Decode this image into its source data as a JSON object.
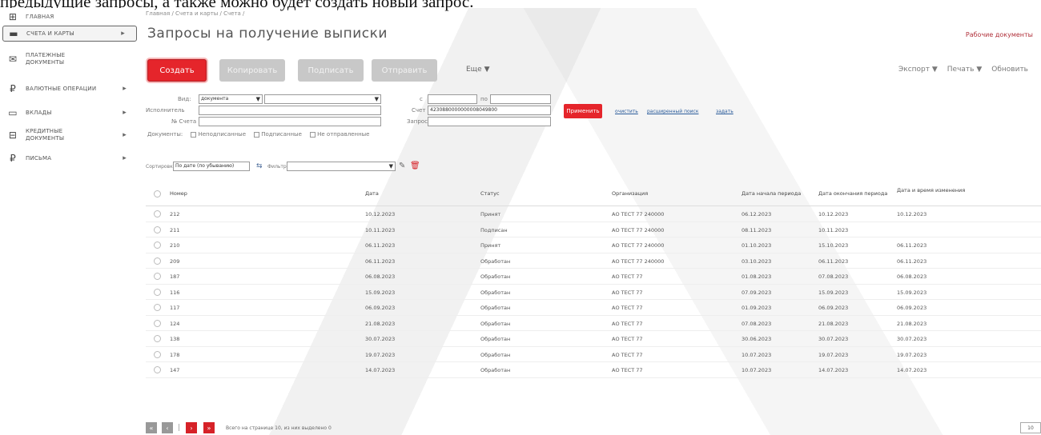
{
  "caption": "предыдущие запросы, а также можно будет создать новый запрос.",
  "sidebar": {
    "items": [
      {
        "label": "Главная",
        "icon": "home-icon",
        "glyph": "⊞",
        "arrow": ""
      },
      {
        "label": "Счета и карты",
        "icon": "card-icon",
        "glyph": "▬",
        "arrow": "▸",
        "active": true
      },
      {
        "label": "Платежные документы",
        "icon": "payment-icon",
        "glyph": "✉",
        "arrow": ""
      },
      {
        "label": "Валютные операции",
        "icon": "currency-icon",
        "glyph": "₽",
        "arrow": "▸"
      },
      {
        "label": "Вклады",
        "icon": "deposit-icon",
        "glyph": "▭",
        "arrow": "▸"
      },
      {
        "label": "Кредитные документы",
        "icon": "credit-icon",
        "glyph": "⊟",
        "arrow": "▸"
      },
      {
        "label": "Письма",
        "icon": "letter-icon",
        "glyph": "₽",
        "arrow": "▸"
      }
    ]
  },
  "header": {
    "breadcrumb": "Главная / Счета и карты / Счета /",
    "title": "Запросы на получение выписки",
    "work_docs": "Рабочие документы"
  },
  "toolbar": {
    "create": "Создать",
    "copy": "Копировать",
    "sign": "Подписать",
    "send": "Отправить",
    "still": "Еще",
    "export": "Экспорт",
    "print": "Печать",
    "refresh": "Обновить"
  },
  "filter": {
    "doc_type_label": "Вид:",
    "doc_type_value": "документа",
    "employee_label": "Исполнитель",
    "account_num_label": "№ Счета",
    "from_label": "с",
    "to_label": "по",
    "account_label": "Счет",
    "account_value": "4230880000000008049800",
    "status_label": "Запрос",
    "apply": "Применить",
    "link_reset": "очистить",
    "link_extended": "расширенный поиск",
    "link_save": "задать",
    "docs_label": "Документы:",
    "chk_unsigned": "Неподписанные",
    "chk_signed": "Подписанные",
    "chk_sent": "Не отправленные"
  },
  "sortrow": {
    "sort_label": "Сортировка",
    "sort_value": "По дате (по убыванию)",
    "filter_label": "Фильтр"
  },
  "table": {
    "headers": [
      "Номер",
      "Дата",
      "Статус",
      "Организация",
      "Дата начала периода",
      "Дата окончания периода",
      "Дата и время изменения"
    ],
    "rows": [
      [
        "212",
        "10.12.2023",
        "Принят",
        "АО ТЕСТ 77 240000",
        "06.12.2023",
        "10.12.2023",
        "10.12.2023"
      ],
      [
        "211",
        "10.11.2023",
        "Подписан",
        "АО ТЕСТ 77 240000",
        "08.11.2023",
        "10.11.2023",
        ""
      ],
      [
        "210",
        "06.11.2023",
        "Принят",
        "АО ТЕСТ 77 240000",
        "01.10.2023",
        "15.10.2023",
        "06.11.2023"
      ],
      [
        "209",
        "06.11.2023",
        "Обработан",
        "АО ТЕСТ 77 240000",
        "03.10.2023",
        "06.11.2023",
        "06.11.2023"
      ],
      [
        "187",
        "06.08.2023",
        "Обработан",
        "АО ТЕСТ 77",
        "01.08.2023",
        "07.08.2023",
        "06.08.2023"
      ],
      [
        "116",
        "15.09.2023",
        "Обработан",
        "АО ТЕСТ 77",
        "07.09.2023",
        "15.09.2023",
        "15.09.2023"
      ],
      [
        "117",
        "06.09.2023",
        "Обработан",
        "АО ТЕСТ 77",
        "01.09.2023",
        "06.09.2023",
        "06.09.2023"
      ],
      [
        "124",
        "21.08.2023",
        "Обработан",
        "АО ТЕСТ 77",
        "07.08.2023",
        "21.08.2023",
        "21.08.2023"
      ],
      [
        "138",
        "30.07.2023",
        "Обработан",
        "АО ТЕСТ 77",
        "30.06.2023",
        "30.07.2023",
        "30.07.2023"
      ],
      [
        "178",
        "19.07.2023",
        "Обработан",
        "АО ТЕСТ 77",
        "10.07.2023",
        "19.07.2023",
        "19.07.2023"
      ],
      [
        "147",
        "14.07.2023",
        "Обработан",
        "АО ТЕСТ 77",
        "10.07.2023",
        "14.07.2023",
        "14.07.2023"
      ]
    ]
  },
  "pager": {
    "first": "«",
    "prev": "‹",
    "sep": "|",
    "next": "›",
    "last": "»",
    "info": "Всего на странице 10, из них выделено 0",
    "size": "10"
  },
  "colors": {
    "accent_red": "#e5252b",
    "link_blue": "#2a5b9a",
    "work_docs": "#b0303a"
  }
}
